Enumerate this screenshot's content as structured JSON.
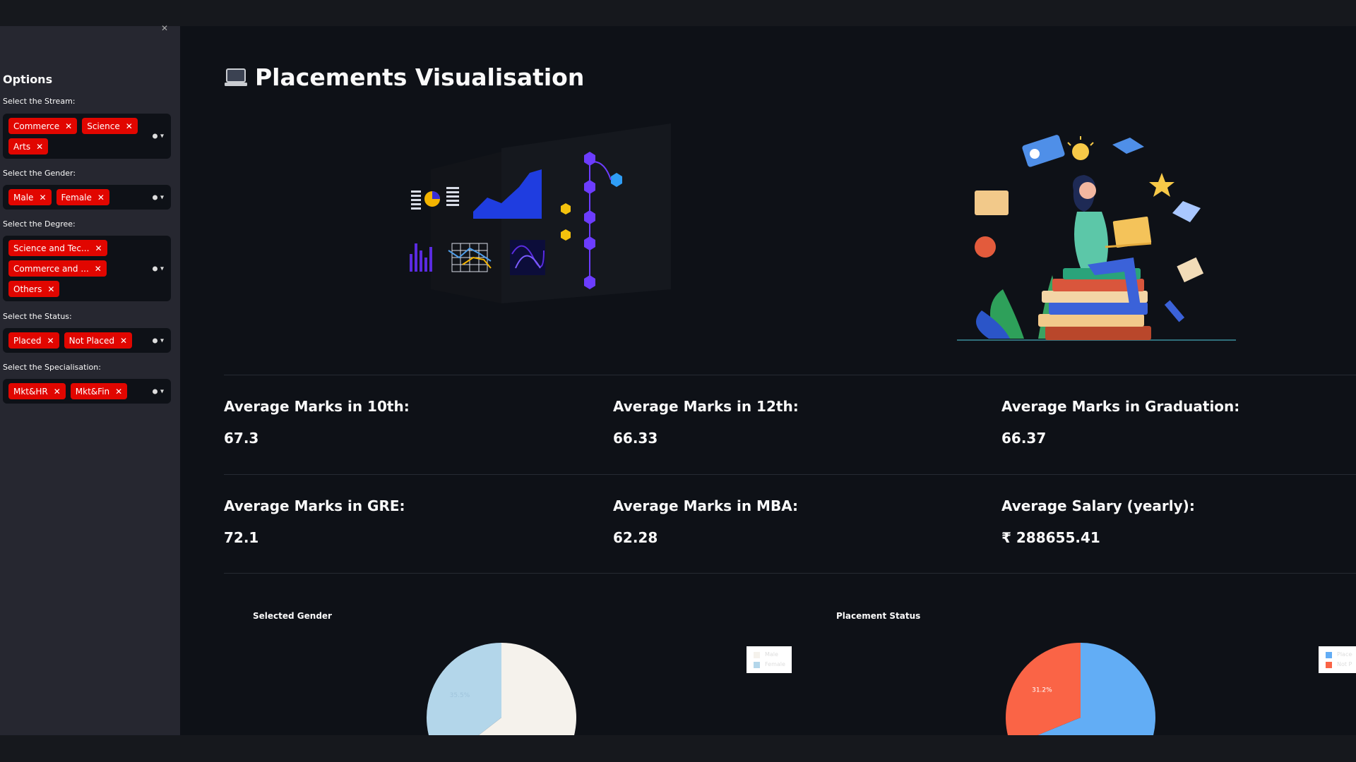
{
  "app": {
    "title": "Placements Visualisation"
  },
  "sidebar": {
    "title": "Options",
    "filters": [
      {
        "label": "Select the Stream:",
        "tags": [
          "Commerce",
          "Science",
          "Arts"
        ]
      },
      {
        "label": "Select the Gender:",
        "tags": [
          "Male",
          "Female"
        ]
      },
      {
        "label": "Select the Degree:",
        "tags": [
          "Science and Tec...",
          "Commerce and ...",
          "Others"
        ]
      },
      {
        "label": "Select the Status:",
        "tags": [
          "Placed",
          "Not Placed"
        ]
      },
      {
        "label": "Select the Specialisation:",
        "tags": [
          "Mkt&HR",
          "Mkt&Fin"
        ]
      }
    ],
    "remove_glyph": "✕"
  },
  "metrics": [
    {
      "label": "Average Marks in 10th:",
      "value": "67.3"
    },
    {
      "label": "Average Marks in 12th:",
      "value": "66.33"
    },
    {
      "label": "Average Marks in Graduation:",
      "value": "66.37"
    },
    {
      "label": "Average Marks in GRE:",
      "value": "72.1"
    },
    {
      "label": "Average Marks in MBA:",
      "value": "62.28"
    },
    {
      "label": "Average Salary (yearly):",
      "value": "₹ 288655.41"
    }
  ],
  "chart_data": [
    {
      "type": "pie",
      "title": "Selected Gender",
      "categories": [
        "Male",
        "Female"
      ],
      "values": [
        64.5,
        35.5
      ],
      "data_labels": [
        "",
        "35.5%"
      ],
      "colors": [
        "#f5f2ec",
        "#b3d6ea"
      ],
      "legend": "right"
    },
    {
      "type": "pie",
      "title": "Placement Status",
      "categories": [
        "Placed",
        "Not Placed"
      ],
      "values": [
        68.8,
        31.2
      ],
      "data_labels": [
        "",
        "31.2%"
      ],
      "colors": [
        "#62adf5",
        "#fa6446"
      ],
      "legend": "right"
    }
  ],
  "colors": {
    "accent": "#e10600",
    "background": "#0e1117",
    "sidebar": "#262730"
  },
  "icons": {
    "title": "laptop-icon",
    "clear": "clear-icon",
    "dropdown": "chevron-down-icon"
  }
}
